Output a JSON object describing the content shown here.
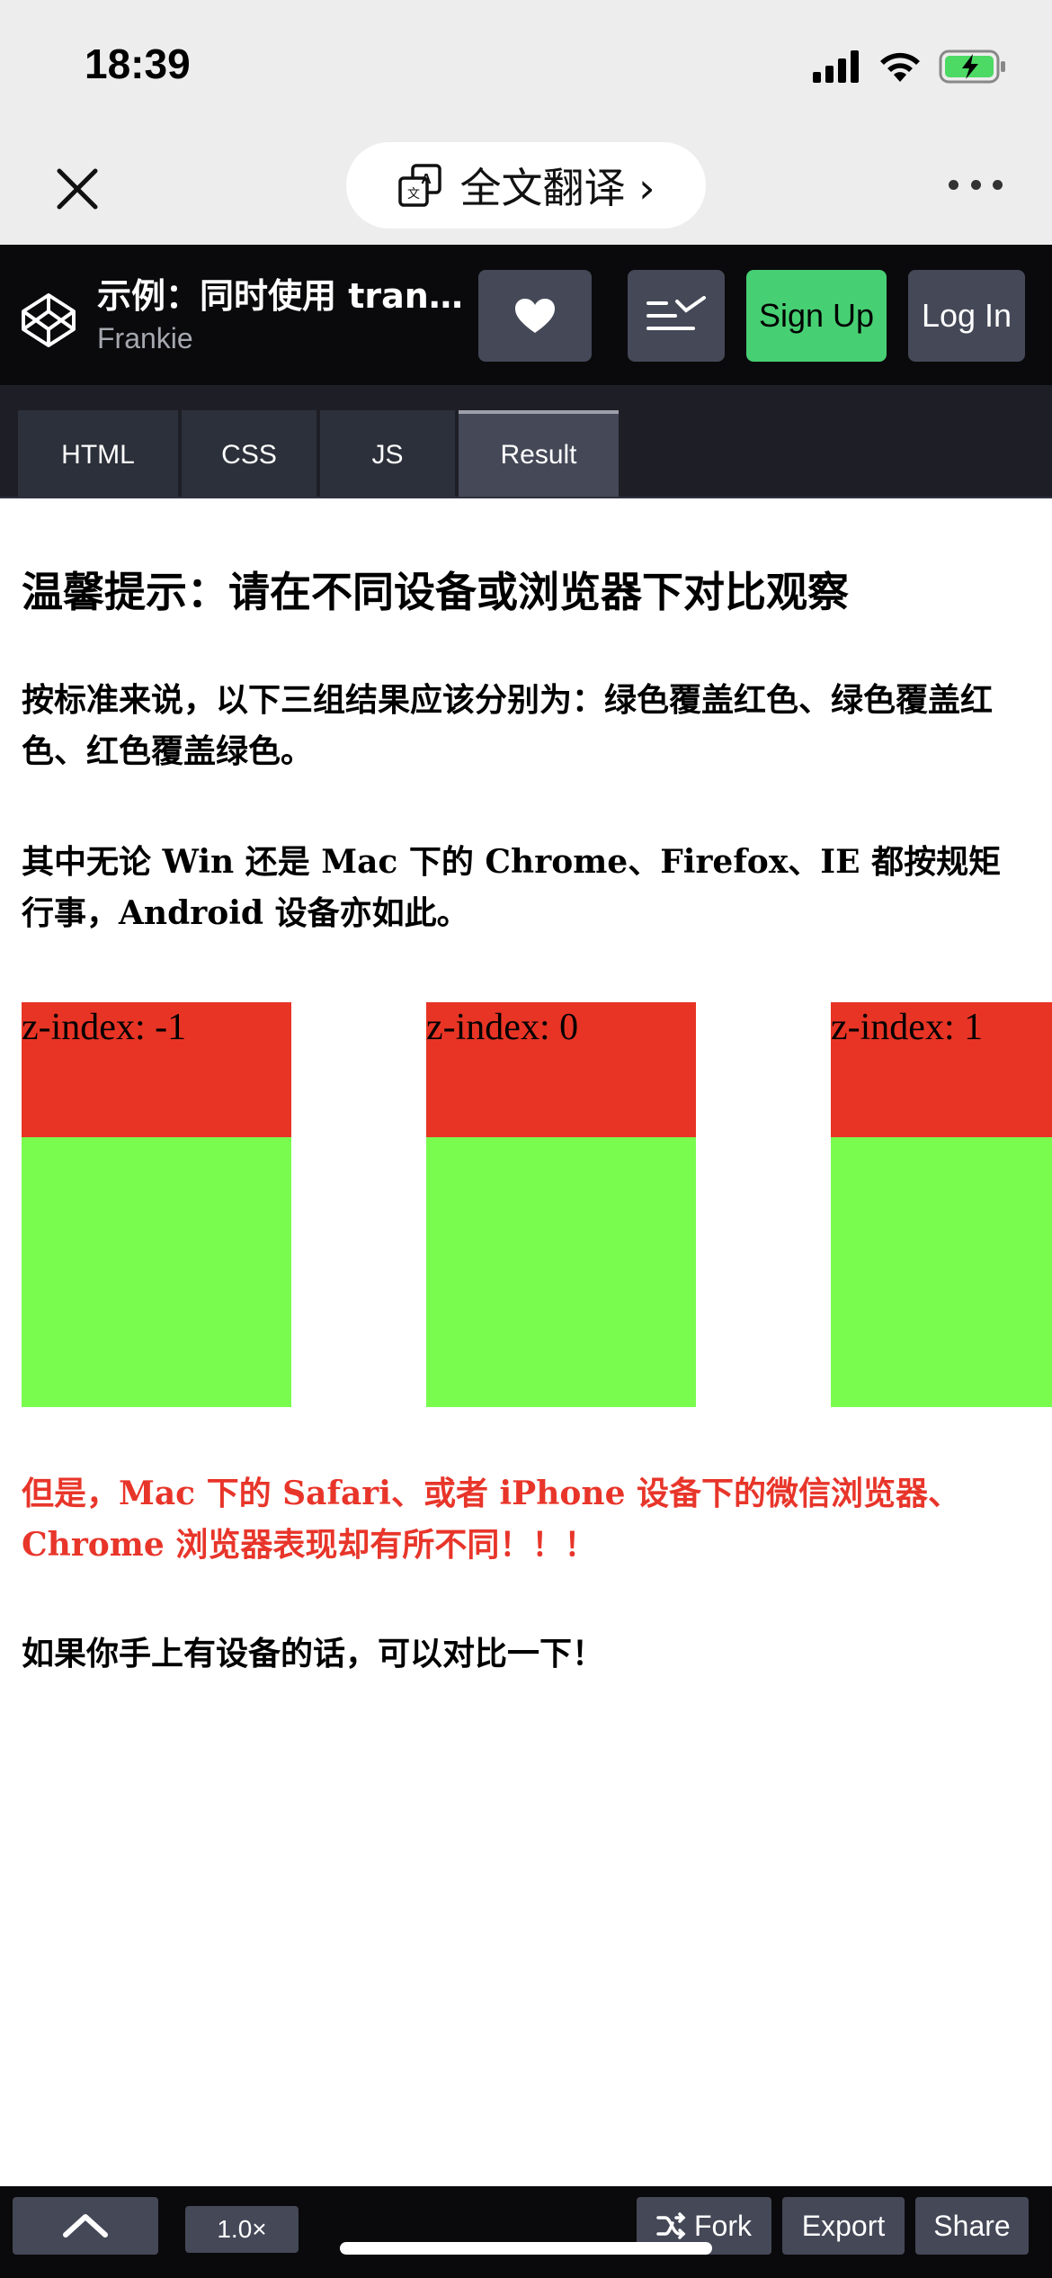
{
  "status_bar": {
    "time": "18:39"
  },
  "wechat_nav": {
    "translate_label": "全文翻译 ›"
  },
  "codepen_header": {
    "title": "示例：同时使用 transf…",
    "author": "Frankie",
    "signup_label": "Sign Up",
    "login_label": "Log In"
  },
  "tabs": [
    {
      "label": "HTML"
    },
    {
      "label": "CSS"
    },
    {
      "label": "JS"
    },
    {
      "label": "Result",
      "active": true
    }
  ],
  "result": {
    "heading": "温馨提示：请在不同设备或浏览器下对比观察",
    "p1": "按标准来说，以下三组结果应该分别为：绿色覆盖红色、绿色覆盖红色、红色覆盖绿色。",
    "p2": "其中无论 Win 还是 Mac 下的 Chrome、Firefox、IE 都按规矩行事，Android 设备亦如此。",
    "boxes": [
      {
        "caption": "z-index: -1"
      },
      {
        "caption": "z-index: 0"
      },
      {
        "caption": "z-index: 1"
      }
    ],
    "p3": "但是，Mac 下的 Safari、或者 iPhone 设备下的微信浏览器、Chrome 浏览器表现却有所不同！！！",
    "p4": "如果你手上有设备的话，可以对比一下！"
  },
  "bottom_bar": {
    "zoom": "1.0×",
    "fork_label": "Fork",
    "export_label": "Export",
    "share_label": "Share"
  },
  "colors": {
    "red_box": "#e83425",
    "green_box": "#7afc4f",
    "signup": "#47cf73",
    "warning_text": "#e8352a"
  },
  "icons": [
    "signal-icon",
    "wifi-icon",
    "battery-charging-icon",
    "close-icon",
    "translate-icon",
    "more-icon",
    "codepen-logo-icon",
    "heart-icon",
    "layout-icon",
    "chevron-up-icon",
    "fork-icon"
  ]
}
